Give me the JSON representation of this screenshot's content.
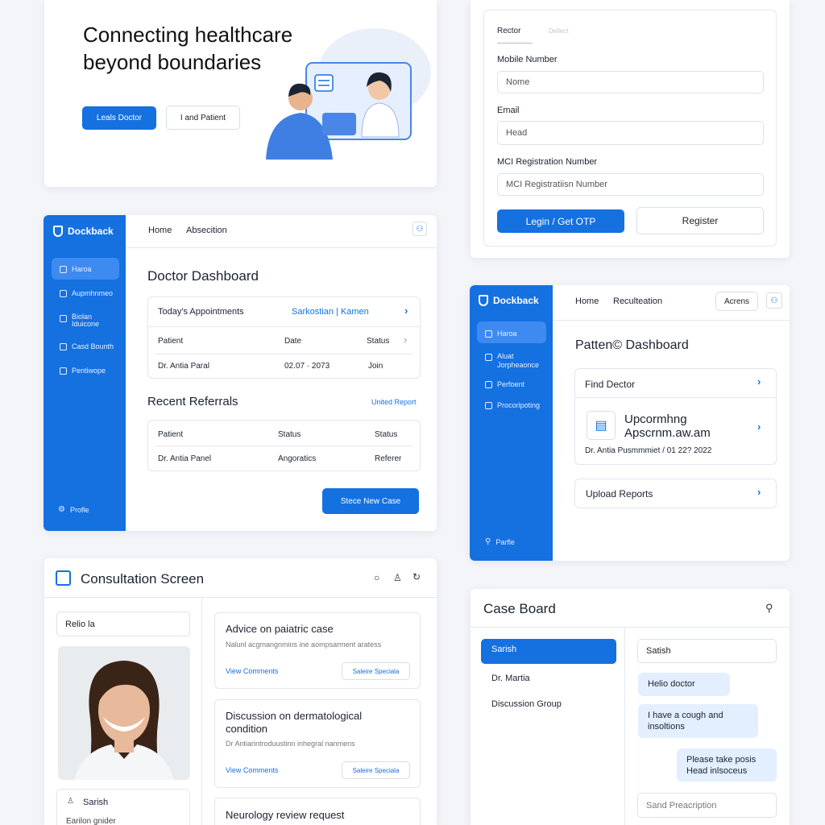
{
  "hero": {
    "title_line1": "Connecting healthcare",
    "title_line2": "beyond boundaries",
    "primary_button": "Leals Doctor",
    "secondary_button": "I and Patient"
  },
  "login": {
    "tab_active": "Rector",
    "tab_inactive": "Dellect",
    "mobile_label": "Mobile Number",
    "mobile_value": "Nome",
    "email_label": "Email",
    "email_value": "Head",
    "mci_label": "MCI Registration Number",
    "mci_placeholder": "MCI Registratiisn Number",
    "login_button": "Legin / Get OTP",
    "register_button": "Register"
  },
  "doctor_dash": {
    "brand": "Dockback",
    "sidebar": [
      "Haroa",
      "Aupmhnmeo",
      "Biolan",
      "Iduicone",
      "Casd Bounth",
      "Pentiwope"
    ],
    "profile": "Profle",
    "nav": [
      "Home",
      "Absecition"
    ],
    "title": "Doctor Dashboard",
    "appointments": {
      "title": "Today's Appointments",
      "link": "Sarkostian | Kamen",
      "headers": [
        "Patient",
        "Date",
        "Status"
      ],
      "row": [
        "Dr. Antia Paral",
        "02.07 · 2073",
        "Join"
      ]
    },
    "referrals": {
      "title": "Recent Referrals",
      "link": "United Report",
      "headers": [
        "Patient",
        "Status",
        "Status"
      ],
      "row": [
        "Dr. Antia Panel",
        "Angoratics",
        "Referer"
      ]
    },
    "new_case_button": "Stece New Case"
  },
  "patient_dash": {
    "brand": "Dockback",
    "sidebar": [
      "Haroa",
      "Aluat",
      "Jorpheaonce",
      "Perfoent",
      "Procoripoting"
    ],
    "profile": "Parfle",
    "nav": [
      "Home",
      "Reculteation"
    ],
    "action_button": "Acrens",
    "title": "Patten© Dashboard",
    "find_doctor": "Find Dector",
    "upcoming_line1": "Upcormhng",
    "upcoming_line2": "Apscrnm.aw.am",
    "upcoming_detail": "Dr. Antia Pusmmmiet / 01 22? 2022",
    "upload": "Upload Reports"
  },
  "consult": {
    "title": "Consultation Screen",
    "search_value": "Relio la",
    "doctor_name": "Sarish",
    "doctor_role": "Earilon gnider",
    "cases": [
      {
        "title": "Advice on paiatric case",
        "desc": "Nalunl acgmangnmins ine aompsarment aratess",
        "link": "View Comments",
        "tag": "Saleire Speciala"
      },
      {
        "title": "Discussion on dermatological",
        "title2": "condition",
        "desc": "Dr Antiarintroduustinn inhegral nanmens",
        "link": "View Comments",
        "tag": "Saleire Speciala"
      },
      {
        "title": "Neurology review request"
      }
    ]
  },
  "case_board": {
    "title": "Case Board",
    "list": [
      "Sarish",
      "Dr. Martia",
      "Discussion Group"
    ],
    "chat_header": "Satish",
    "messages": [
      {
        "text": "Helio doctor",
        "side": "left"
      },
      {
        "text": "I have a cough and insoltions",
        "side": "left"
      },
      {
        "text": "Please take posis Head inlsoceus",
        "side": "right"
      }
    ],
    "input_placeholder": "Sand Preacription"
  },
  "colors": {
    "accent": "#1570e0",
    "bubble": "#e3efff"
  }
}
